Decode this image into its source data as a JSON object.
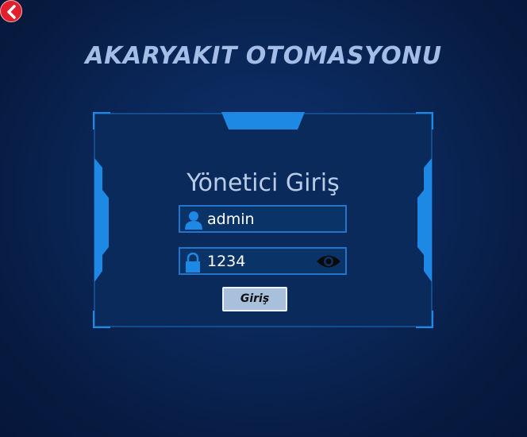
{
  "app": {
    "title": "AKARYAKIT OTOMASYONU"
  },
  "nav": {
    "back_icon": "chevron-left-icon"
  },
  "login": {
    "title": "Yönetici Giriş",
    "username": {
      "value": "admin",
      "icon": "user-icon"
    },
    "password": {
      "value": "1234",
      "icon": "lock-icon",
      "toggle_icon": "eye-icon"
    },
    "submit_label": "Giriş"
  },
  "colors": {
    "background": "#0a2657",
    "accent": "#1e88e5",
    "title": "#a3bde6",
    "back_button": "#e0202c"
  }
}
